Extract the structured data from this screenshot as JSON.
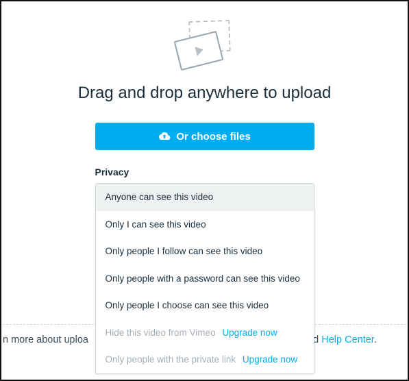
{
  "headline": "Drag and drop anywhere to upload",
  "choose_button_label": "Or choose files",
  "privacy": {
    "label": "Privacy",
    "options": [
      {
        "label": "Anyone can see this video",
        "selected": true,
        "disabled": false
      },
      {
        "label": "Only I can see this video",
        "selected": false,
        "disabled": false
      },
      {
        "label": "Only people I follow can see this video",
        "selected": false,
        "disabled": false
      },
      {
        "label": "Only people with a password can see this video",
        "selected": false,
        "disabled": false
      },
      {
        "label": "Only people I choose can see this video",
        "selected": false,
        "disabled": false
      },
      {
        "label": "Hide this video from Vimeo",
        "selected": false,
        "disabled": true,
        "upgrade": "Upgrade now"
      },
      {
        "label": "Only people with the private link",
        "selected": false,
        "disabled": true,
        "upgrade": "Upgrade now"
      }
    ]
  },
  "footer": {
    "pre_text": "n more about uploa",
    "mid_text": "and ",
    "help_link": "Help Center",
    "period": "."
  }
}
